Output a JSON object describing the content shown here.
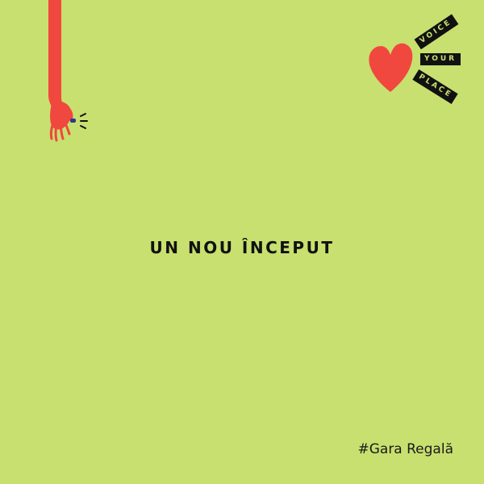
{
  "background_color": "#c8e06f",
  "accent_color": "#f0483e",
  "text_color": "#111111",
  "logo": {
    "words": [
      "VOICE",
      "YOUR",
      "PLACE"
    ],
    "icon": "heart-icon"
  },
  "illustration": {
    "icon": "hand-icon"
  },
  "headline": "UN NOU ÎNCEPUT",
  "hashtag": "#Gara Regală"
}
